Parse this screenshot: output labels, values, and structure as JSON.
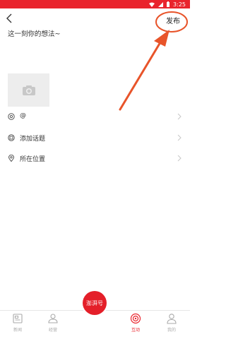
{
  "status_bar": {
    "time": "3:25"
  },
  "header": {
    "publish_label": "发布"
  },
  "composer": {
    "prompt": "这一刻你的想法~"
  },
  "options": [
    {
      "label": "@"
    },
    {
      "label": "添加话题"
    },
    {
      "label": "所在位置"
    }
  ],
  "tabbar": {
    "tabs": [
      {
        "label": "新闻"
      },
      {
        "label": "经营"
      },
      {
        "label": "互动"
      },
      {
        "label": "我的"
      }
    ],
    "center_label": "澎湃号"
  },
  "colors": {
    "accent": "#e9242d",
    "annotation": "#e8542a"
  },
  "icons": [
    "back-icon",
    "camera-icon",
    "at-icon",
    "topic-icon",
    "location-icon",
    "chevron-right-icon",
    "news-icon",
    "business-icon",
    "interact-icon",
    "profile-icon",
    "wifi-icon",
    "signal-icon",
    "battery-icon"
  ]
}
